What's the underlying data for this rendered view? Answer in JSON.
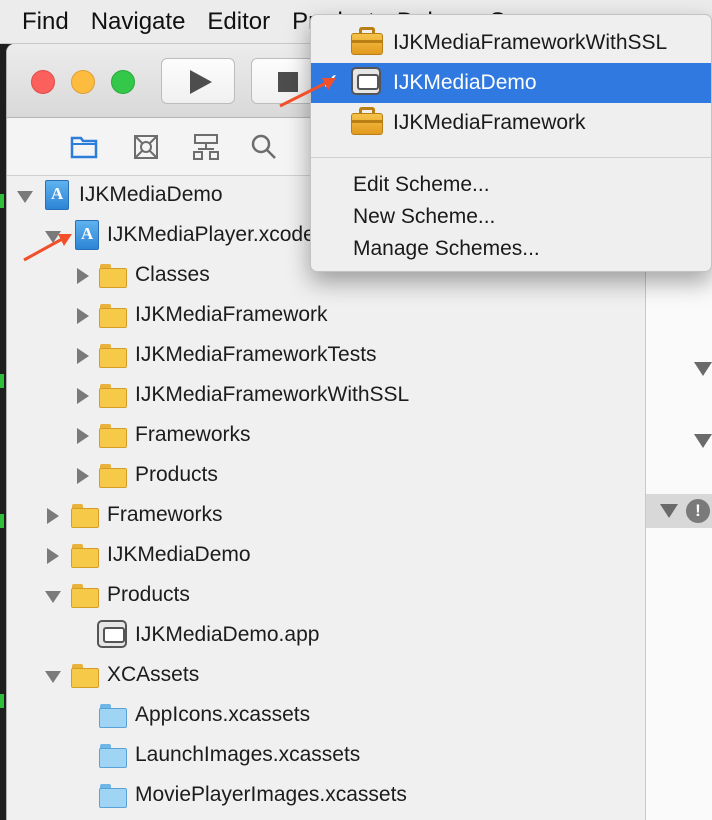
{
  "menubar": {
    "items": [
      "Find",
      "Navigate",
      "Editor",
      "Product",
      "Debug",
      "Source"
    ]
  },
  "toolbar": {
    "run_icon": "play-icon",
    "stop_icon": "stop-icon"
  },
  "navigator_tabs": [
    "folder-icon",
    "symbol-icon",
    "hierarchy-icon",
    "search-icon"
  ],
  "scheme_menu": {
    "schemes": [
      {
        "label": "IJKMediaFrameworkWithSSL",
        "icon": "toolbox-icon",
        "selected": false
      },
      {
        "label": "IJKMediaDemo",
        "icon": "tv-app-icon",
        "selected": true
      },
      {
        "label": "IJKMediaFramework",
        "icon": "toolbox-icon",
        "selected": false
      }
    ],
    "actions": [
      "Edit Scheme...",
      "New Scheme...",
      "Manage Schemes..."
    ],
    "selected_color": "#2f79e0"
  },
  "tree": {
    "items": [
      {
        "label": "IJKMediaDemo",
        "icon": "project-icon",
        "expanded": true
      },
      {
        "label": "IJKMediaPlayer.xcodeproj",
        "icon": "project-icon",
        "expanded": true
      },
      {
        "label": "Classes",
        "icon": "folder-icon",
        "expanded": false
      },
      {
        "label": "IJKMediaFramework",
        "icon": "folder-icon",
        "expanded": false
      },
      {
        "label": "IJKMediaFrameworkTests",
        "icon": "folder-icon",
        "expanded": false
      },
      {
        "label": "IJKMediaFrameworkWithSSL",
        "icon": "folder-icon",
        "expanded": false
      },
      {
        "label": "Frameworks",
        "icon": "folder-icon",
        "expanded": false
      },
      {
        "label": "Products",
        "icon": "folder-icon",
        "expanded": false
      },
      {
        "label": "Frameworks",
        "icon": "folder-icon",
        "expanded": false
      },
      {
        "label": "IJKMediaDemo",
        "icon": "folder-icon",
        "expanded": false
      },
      {
        "label": "Products",
        "icon": "folder-icon",
        "expanded": true
      },
      {
        "label": "IJKMediaDemo.app",
        "icon": "tv-app-icon"
      },
      {
        "label": "XCAssets",
        "icon": "folder-icon",
        "expanded": true
      },
      {
        "label": "AppIcons.xcassets",
        "icon": "asset-folder-icon"
      },
      {
        "label": "LaunchImages.xcassets",
        "icon": "asset-folder-icon"
      },
      {
        "label": "MoviePlayerImages.xcassets",
        "icon": "asset-folder-icon"
      }
    ]
  },
  "editor": {
    "warning_glyph": "!"
  },
  "annotations": {
    "arrow_color": "#f0502a"
  }
}
